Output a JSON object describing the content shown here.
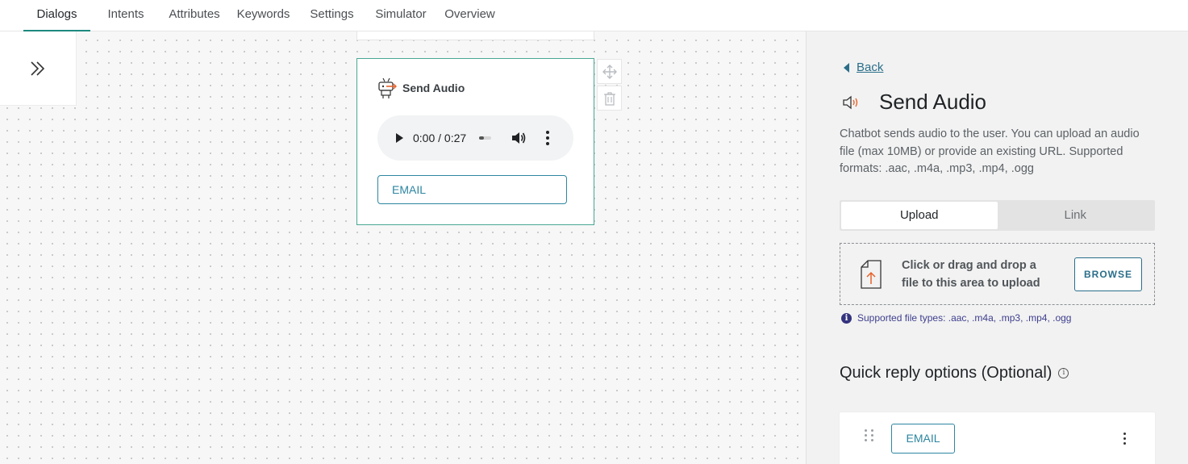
{
  "nav": {
    "tabs": [
      {
        "label": "Dialogs",
        "active": true
      },
      {
        "label": "Intents"
      },
      {
        "label": "Attributes"
      },
      {
        "label": "Keywords"
      },
      {
        "label": "Settings"
      },
      {
        "label": "Simulator"
      },
      {
        "label": "Overview"
      }
    ]
  },
  "canvas": {
    "collapse_icon": "double-chevron-right-icon",
    "node": {
      "icon": "robot-audio-icon",
      "title": "Send Audio",
      "audio": {
        "time": "0:00 / 0:27",
        "progress": 0
      },
      "quick_reply_label": "EMAIL",
      "tools": [
        "move-icon",
        "trash-icon"
      ]
    }
  },
  "panel": {
    "back_label": "Back",
    "title": "Send Audio",
    "title_icon": "speaker-icon",
    "description": "Chatbot sends audio to the user. You can upload an audio file (max 10MB) or provide an existing URL. Supported formats: .aac, .m4a, .mp3, .mp4, .ogg",
    "segments": [
      {
        "label": "Upload",
        "active": true
      },
      {
        "label": "Link"
      }
    ],
    "dropzone": {
      "text": "Click or drag and drop a file to this area to upload",
      "browse_label": "BROWSE"
    },
    "hint": "Supported file types: .aac, .m4a, .mp3, .mp4, .ogg",
    "quick_replies": {
      "title": "Quick reply options (Optional)",
      "items": [
        {
          "label": "EMAIL"
        }
      ]
    }
  },
  "colors": {
    "accent_green": "#1c8a7e",
    "link_blue": "#2a6e8a",
    "button_blue": "#2d86a1",
    "node_border": "#4aa794"
  }
}
